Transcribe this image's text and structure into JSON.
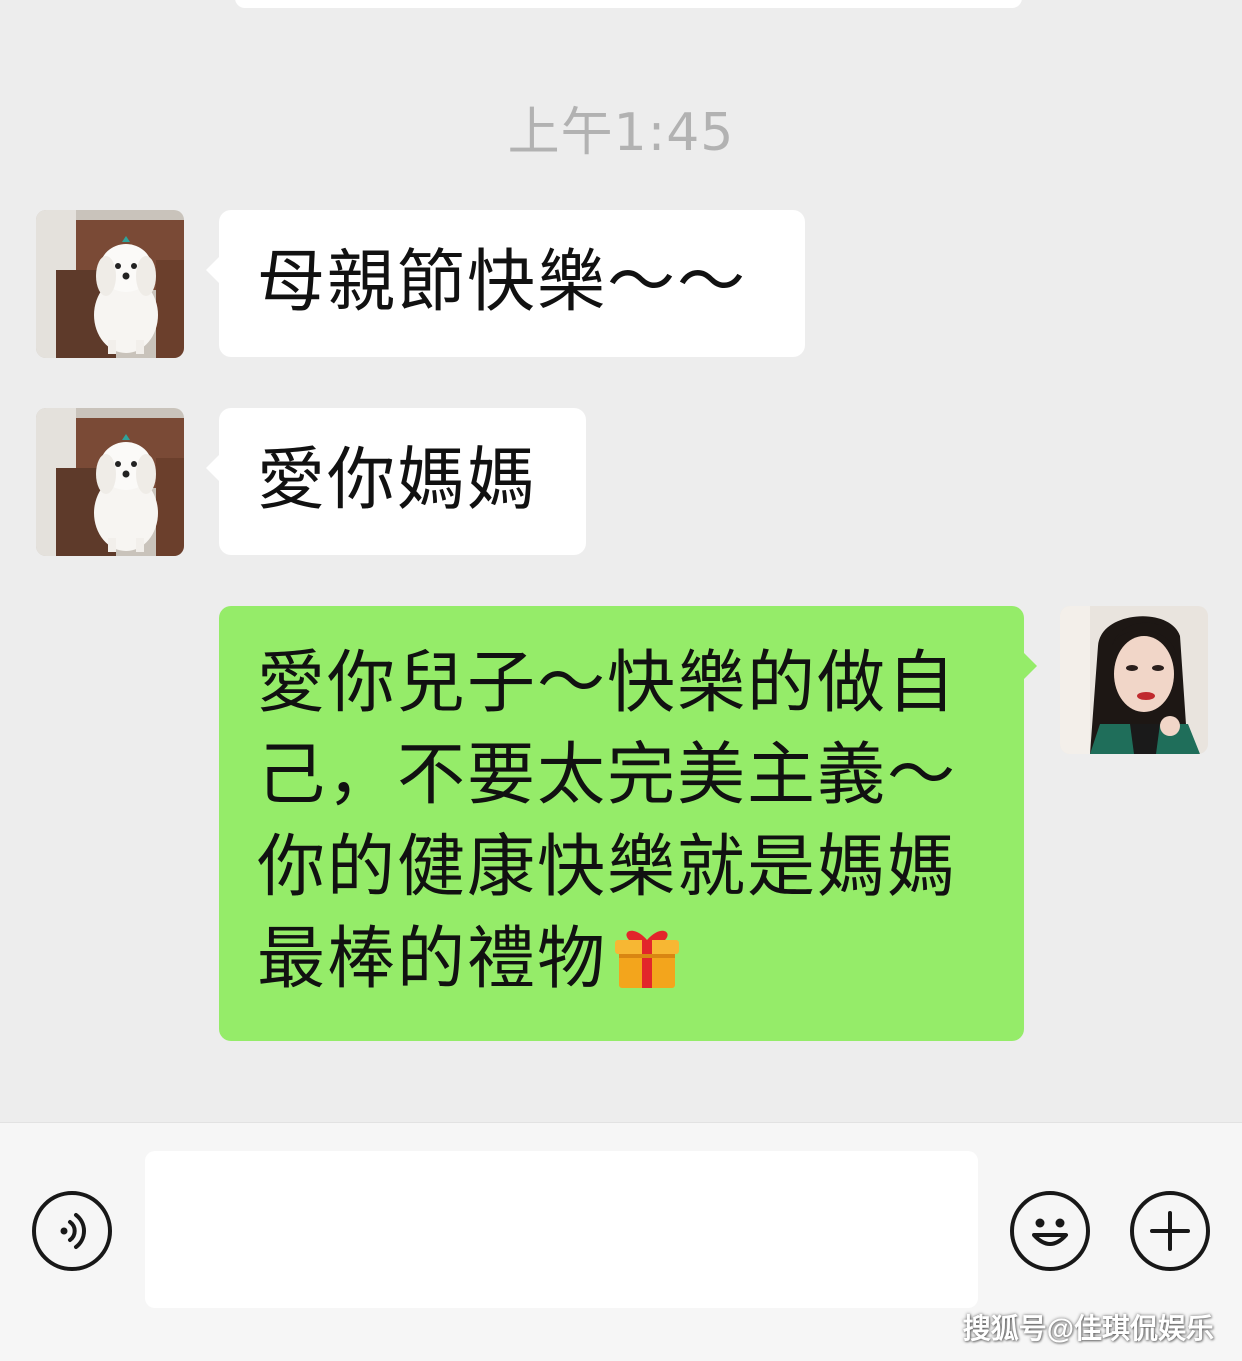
{
  "chat": {
    "timestamp": "上午1:45",
    "messages": [
      {
        "sender": "dog",
        "direction": "incoming",
        "text": "母親節快樂～～"
      },
      {
        "sender": "dog",
        "direction": "incoming",
        "text": "愛你媽媽"
      },
      {
        "sender": "woman",
        "direction": "outgoing",
        "text": "愛你兒子～快樂的做自己，不要太完美主義～你的健康快樂就是媽媽最棒的禮物",
        "emoji": "gift-emoji"
      }
    ]
  },
  "input_bar": {
    "input_value": "",
    "voice_icon": "voice-icon",
    "emoji_icon": "smiley-icon",
    "more_icon": "plus-icon"
  },
  "watermark": "搜狐号@佳琪侃娱乐",
  "colors": {
    "background": "#ededed",
    "incoming_bubble": "#ffffff",
    "outgoing_bubble": "#95ec69",
    "timestamp": "#b2b2b2"
  }
}
